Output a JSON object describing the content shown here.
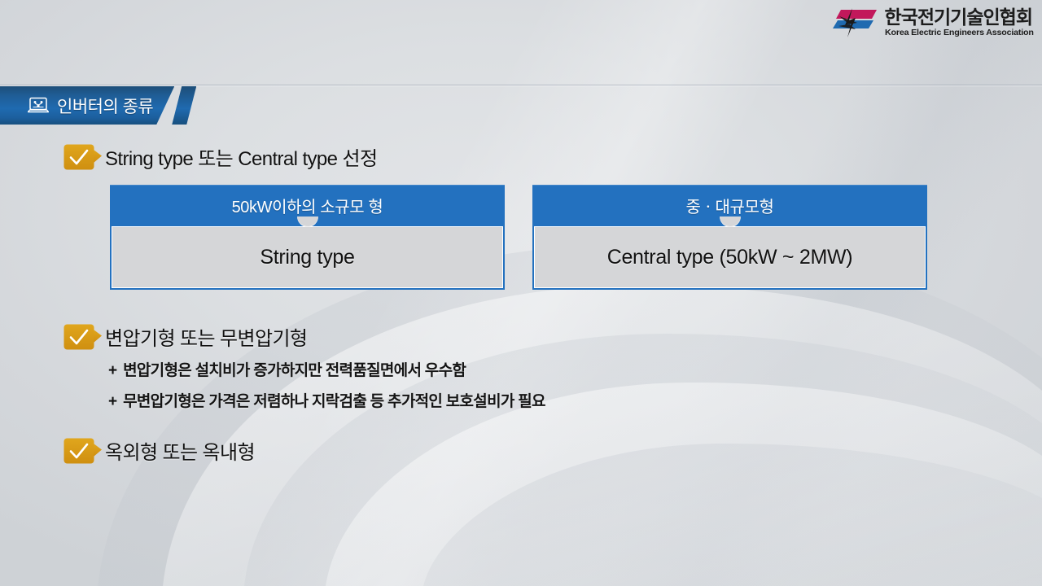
{
  "logo": {
    "icon_name": "kea-logo-mark",
    "name_kr": "한국전기기술인협회",
    "name_en": "Korea Electric Engineers Association",
    "colors": {
      "pink": "#c2185b",
      "blue": "#1f6ab0",
      "dark": "#222222"
    }
  },
  "section": {
    "icon_name": "laptop-network-icon",
    "title": "인버터의 종류",
    "accent": "#1f6ab0"
  },
  "bullets": [
    {
      "id": "bullet-1",
      "marker": "check",
      "text": "String type 또는 Central type  선정"
    },
    {
      "id": "bullet-2",
      "marker": "check",
      "text": "변압기형 또는 무변압기형"
    },
    {
      "id": "bullet-3",
      "marker": "check",
      "text": "옥외형 또는 옥내형"
    }
  ],
  "sub_items": [
    {
      "id": "sub-1",
      "marker": "+",
      "text": "변압기형은 설치비가 증가하지만 전력품질면에서 우수함"
    },
    {
      "id": "sub-2",
      "marker": "+",
      "text": "무변압기형은 가격은 저렴하나 지락검출 등 추가적인 보호설비가 필요"
    }
  ],
  "cards": [
    {
      "id": "card-small",
      "header": "50kW이하의 소규모 형",
      "body": "String type"
    },
    {
      "id": "card-large",
      "header": "중ㆍ대규모형",
      "body": "Central type (50kW ~ 2MW)"
    }
  ],
  "theme": {
    "header_blue": "#2371bf",
    "tab_blue": "#1f6ab0",
    "badge_gold": "#d99a1a",
    "card_gray": "#d5d6d8",
    "background": "#d7dadd"
  }
}
